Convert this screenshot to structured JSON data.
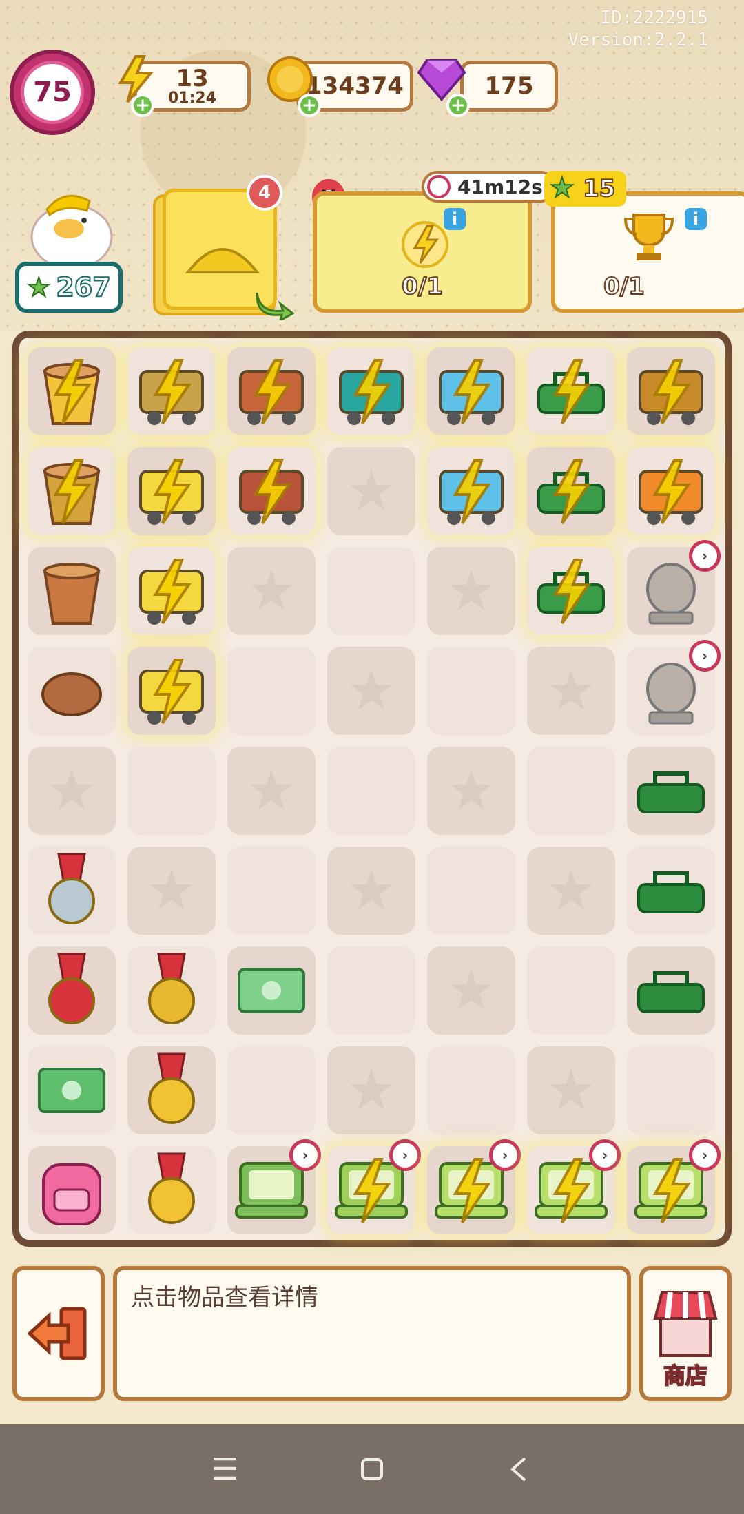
{
  "meta": {
    "id_label": "ID:2222915",
    "version_label": "Version:2.2.1"
  },
  "player": {
    "level": "75",
    "stars": "267"
  },
  "resources": {
    "energy": {
      "value": "13",
      "timer": "01:24"
    },
    "coins": {
      "value": "134374"
    },
    "gems": {
      "value": "175"
    }
  },
  "tasks": {
    "order_badge": "4",
    "event_timer": "41m12s",
    "event_star_reward": "15",
    "energy_task_progress": "0/1",
    "trophy_task_progress": "0/1"
  },
  "board": {
    "rows": 9,
    "cols": 7,
    "cells": [
      [
        "carrot-pot-energy",
        "cart-wood-energy",
        "tools-barrow-energy",
        "cart-cyan-energy",
        "scale-energy",
        "green-box-energy",
        "basket-energy"
      ],
      [
        "pot-energy",
        "duck-cart-energy",
        "barrow-energy",
        "star",
        "scale-energy",
        "green-box-energy",
        "veg-basket-energy"
      ],
      [
        "clay-pot",
        "duck-cart-energy",
        "star",
        "empty",
        "star",
        "green-box-energy",
        "statue-gen"
      ],
      [
        "clay-lump",
        "duck-cart-energy",
        "empty",
        "star",
        "empty",
        "star",
        "statue-gen"
      ],
      [
        "star",
        "empty",
        "star",
        "empty",
        "star",
        "empty",
        "green-lid"
      ],
      [
        "silver-medal",
        "star",
        "empty",
        "star",
        "empty",
        "star",
        "green-handle"
      ],
      [
        "red-ribbon-medal",
        "gold-ribbon-medal",
        "money-bill",
        "empty",
        "star",
        "empty",
        "green-toolbox"
      ],
      [
        "money-stack",
        "gold-medal",
        "empty",
        "star",
        "empty",
        "star",
        "empty"
      ],
      [
        "pink-backpack",
        "crown-medal",
        "radio-gen",
        "tv-gen-energy",
        "laptop-gen-energy",
        "laptop-gen-energy",
        "laptop-gen-energy"
      ]
    ]
  },
  "footer": {
    "hint": "点击物品查看详情",
    "shop_label": "商店"
  },
  "colors": {
    "board_border": "#6d4a33",
    "accent_pink": "#c2326e",
    "energy_yellow": "#f5c800"
  }
}
